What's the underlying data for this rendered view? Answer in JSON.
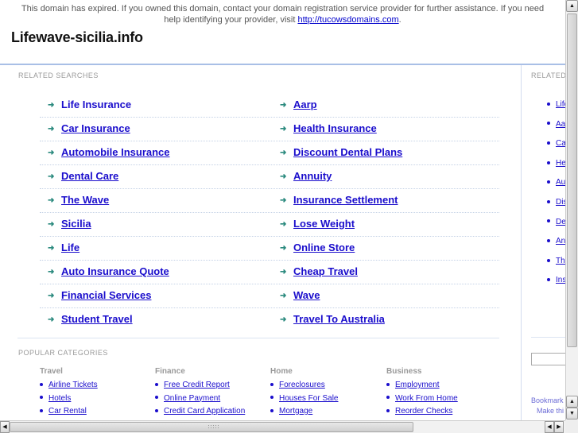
{
  "notice": {
    "text": "This domain has expired. If you owned this domain, contact your domain registration service provider for further assistance. If you need help identifying your provider, visit ",
    "link_text": "http://tucowsdomains.com",
    "suffix": "."
  },
  "site_title": "Lifewave-sicilia.info",
  "related_searches": {
    "label": "RELATED SEARCHES",
    "left": [
      "Life Insurance",
      "Car Insurance",
      "Automobile Insurance",
      "Dental Care",
      "The Wave",
      "Sicilia",
      "Life",
      "Auto Insurance Quote",
      "Financial Services",
      "Student Travel"
    ],
    "right": [
      "Aarp",
      "Health Insurance",
      "Discount Dental Plans",
      "Annuity",
      "Insurance Settlement",
      "Lose Weight",
      "Online Store",
      "Cheap Travel",
      "Wave",
      "Travel To Australia"
    ]
  },
  "popular_categories": {
    "label": "POPULAR CATEGORIES",
    "columns": [
      {
        "heading": "Travel",
        "items": [
          "Airline Tickets",
          "Hotels",
          "Car Rental"
        ]
      },
      {
        "heading": "Finance",
        "items": [
          "Free Credit Report",
          "Online Payment",
          "Credit Card Application"
        ]
      },
      {
        "heading": "Home",
        "items": [
          "Foreclosures",
          "Houses For Sale",
          "Mortgage"
        ]
      },
      {
        "heading": "Business",
        "items": [
          "Employment",
          "Work From Home",
          "Reorder Checks"
        ]
      }
    ]
  },
  "right_column": {
    "label": "RELATED",
    "items": [
      "Life",
      "Aa",
      "Ca",
      "He",
      "Au",
      "Dis",
      "De",
      "An",
      "The",
      "Ins"
    ],
    "bookmark_text": "Bookmark",
    "make_text": "Make thi"
  },
  "colors": {
    "link": "#1a0dcc",
    "arrow": "#2b8a7e",
    "rule": "#a9bfe6"
  }
}
